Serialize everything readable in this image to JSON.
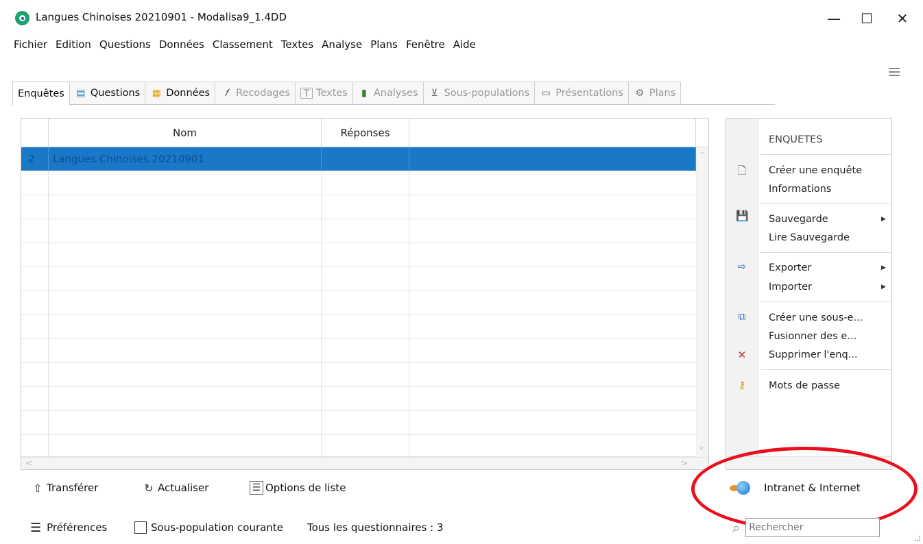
{
  "window": {
    "title": "Langues Chinoises 20210901 - Modalisa9_1.4DD",
    "min_glyph": "—",
    "max_glyph": "☐",
    "close_glyph": "✕"
  },
  "menu": [
    "Fichier",
    "Edition",
    "Questions",
    "Données",
    "Classement",
    "Textes",
    "Analyse",
    "Plans",
    "Fenêtre",
    "Aide"
  ],
  "tabs": [
    {
      "label": "Enquêtes",
      "icon": "",
      "state": "active"
    },
    {
      "label": "Questions",
      "icon": "▤",
      "state": "enabled"
    },
    {
      "label": "Données",
      "icon": "▦",
      "state": "enabled"
    },
    {
      "label": "Recodages",
      "icon": "𝑓",
      "state": "disabled"
    },
    {
      "label": "Textes",
      "icon": "T",
      "state": "disabled"
    },
    {
      "label": "Analyses",
      "icon": "▮",
      "state": "disabled"
    },
    {
      "label": "Sous-populations",
      "icon": "⊻",
      "state": "disabled"
    },
    {
      "label": "Présentations",
      "icon": "▭",
      "state": "disabled"
    },
    {
      "label": "Plans",
      "icon": "⚙",
      "state": "disabled"
    }
  ],
  "table": {
    "headers": {
      "nom": "Nom",
      "reponses": "Réponses"
    },
    "rows": [
      {
        "num": "2",
        "nom": "Langues Chinoises 20210901",
        "reponses": ""
      }
    ],
    "scroll_left": "<",
    "scroll_right": ">",
    "scroll_up": "^",
    "scroll_down": "v"
  },
  "panel": {
    "title": "ENQUETES",
    "creer": "Créer une enquête",
    "informations": "Informations",
    "sauvegarde": "Sauvegarde",
    "lire": "Lire Sauvegarde",
    "exporter": "Exporter",
    "importer": "Importer",
    "creer_sous": "Créer une sous-e...",
    "fusionner": "Fusionner des e...",
    "supprimer": "Supprimer l'enq...",
    "mots": "Mots de passe",
    "arrow": "▶",
    "icon_doc": "🗋",
    "icon_save": "💾",
    "icon_export": "⇨",
    "icon_sub": "⧉",
    "icon_delete": "✕",
    "icon_key": "⚷"
  },
  "toolbar": {
    "transferer": "Transférer",
    "actualiser": "Actualiser",
    "options": "Options de liste",
    "intranet": "Intranet & Internet",
    "icon_upload": "⇧",
    "icon_refresh": "↻",
    "icon_list": "☰"
  },
  "status": {
    "preferences": "Préférences",
    "sous_pop": "Sous-population courante",
    "tous": "Tous les questionnaires : 3",
    "search_placeholder": "Rechercher",
    "icon_pref": "☰",
    "icon_search": "⌕"
  },
  "colors": {
    "selection": "#1a78c8",
    "annotation": "#e8101c"
  }
}
